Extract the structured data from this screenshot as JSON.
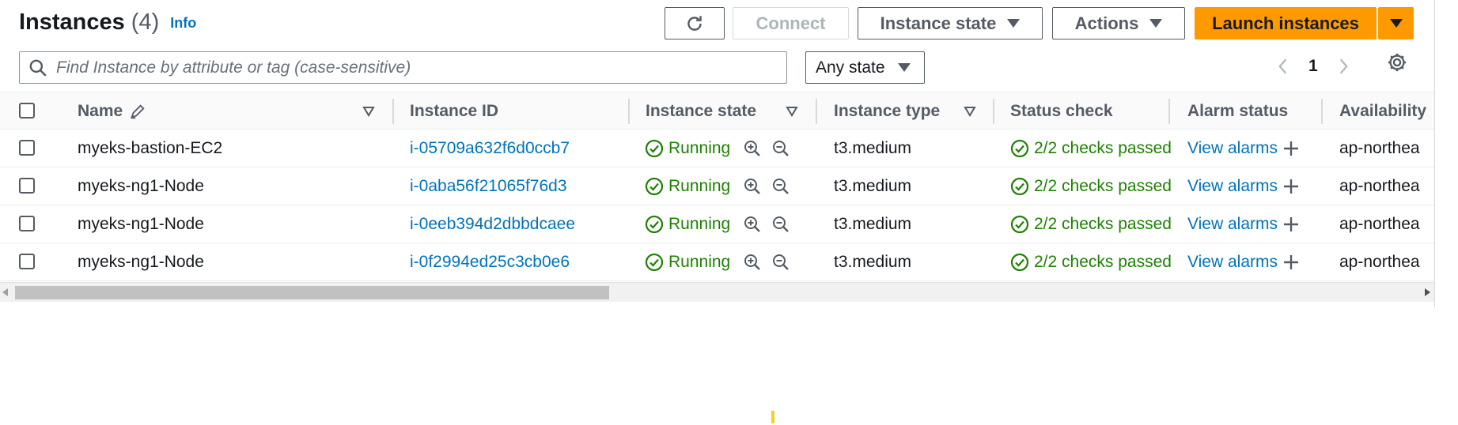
{
  "header": {
    "title": "Instances",
    "count": "(4)",
    "info": "Info"
  },
  "toolbar": {
    "refresh_icon": "refresh-icon",
    "connect": "Connect",
    "instance_state": "Instance state",
    "actions": "Actions",
    "launch": "Launch instances"
  },
  "filter": {
    "placeholder": "Find Instance by attribute or tag (case-sensitive)",
    "state_select": "Any state"
  },
  "pagination": {
    "page": "1"
  },
  "table": {
    "columns": [
      "Name",
      "Instance ID",
      "Instance state",
      "Instance type",
      "Status check",
      "Alarm status",
      "Availability"
    ],
    "rows": [
      {
        "name": "myeks-bastion-EC2",
        "id": "i-05709a632f6d0ccb7",
        "state": "Running",
        "type": "t3.medium",
        "status": "2/2 checks passed",
        "alarm": "View alarms",
        "az": "ap-northea"
      },
      {
        "name": "myeks-ng1-Node",
        "id": "i-0aba56f21065f76d3",
        "state": "Running",
        "type": "t3.medium",
        "status": "2/2 checks passed",
        "alarm": "View alarms",
        "az": "ap-northea"
      },
      {
        "name": "myeks-ng1-Node",
        "id": "i-0eeb394d2dbbdcaee",
        "state": "Running",
        "type": "t3.medium",
        "status": "2/2 checks passed",
        "alarm": "View alarms",
        "az": "ap-northea"
      },
      {
        "name": "myeks-ng1-Node",
        "id": "i-0f2994ed25c3cb0e6",
        "state": "Running",
        "type": "t3.medium",
        "status": "2/2 checks passed",
        "alarm": "View alarms",
        "az": "ap-northea"
      }
    ]
  },
  "colors": {
    "primary": "#ff9900",
    "link": "#0073bb",
    "success": "#1d8102"
  }
}
